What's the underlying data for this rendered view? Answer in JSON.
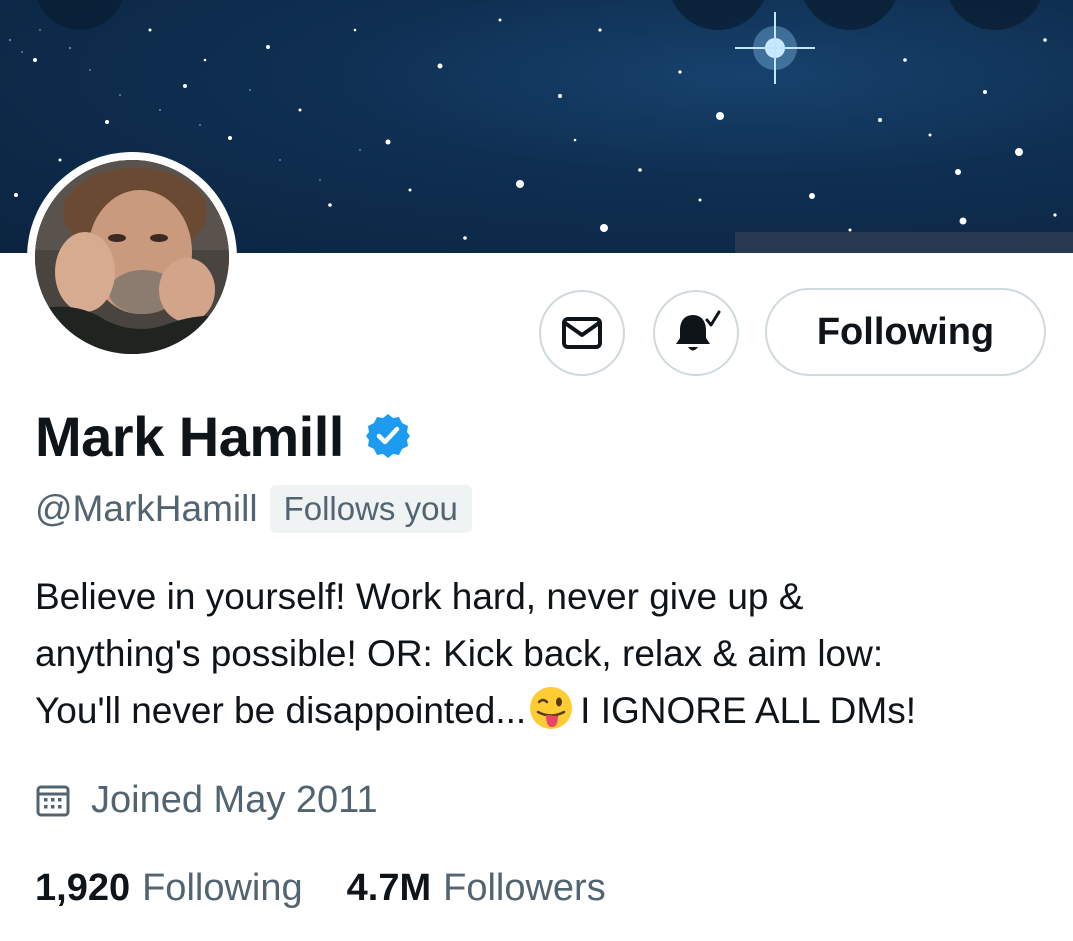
{
  "profile": {
    "display_name": "Mark Hamill",
    "handle": "@MarkHamill",
    "follows_you": "Follows you",
    "bio_lines": [
      "Believe in yourself! Work hard, never give up &",
      "anything's possible! OR: Kick back, relax & aim low:",
      "You'll never be disappointed..."
    ],
    "bio_after_emoji": "I IGNORE ALL DMs!",
    "bio_emoji": "winking-face-with-tongue",
    "joined": "Joined May 2011",
    "verified": true,
    "verified_color": "#1d9bf0"
  },
  "actions": {
    "follow_label": "Following",
    "message_icon": "envelope-icon",
    "notify_icon": "bell-check-icon"
  },
  "stats": {
    "following_count": "1,920",
    "following_label": "Following",
    "followers_count": "4.7M",
    "followers_label": "Followers"
  },
  "colors": {
    "text_primary": "#0f1419",
    "text_secondary": "#536471",
    "border": "#cfd9de",
    "badge_bg": "#eff3f4",
    "banner": "#0f2f52"
  }
}
